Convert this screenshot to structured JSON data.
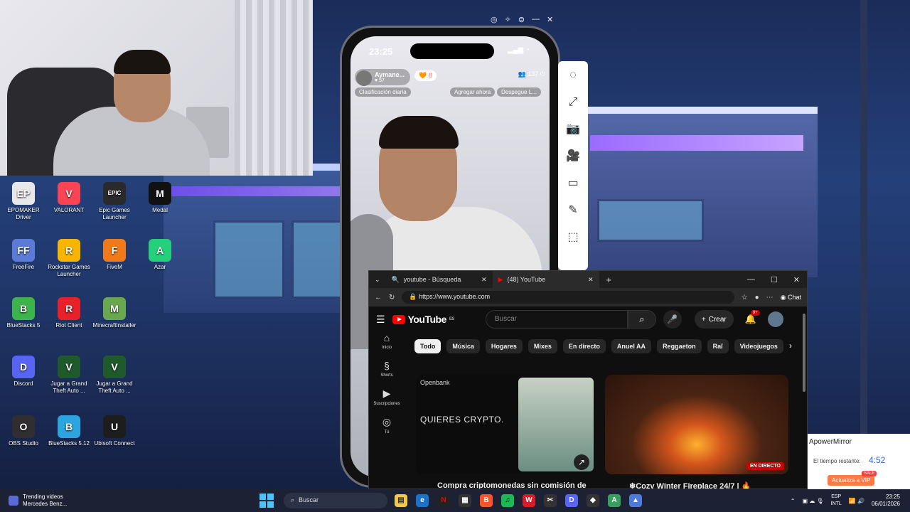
{
  "webcam": {},
  "desktop_icons": [
    {
      "label": "EPOMAKER Driver",
      "icon": "epomaker-icon",
      "color": "#e8e8e8",
      "glyph": "EP"
    },
    {
      "label": "VALORANT",
      "icon": "valorant-icon",
      "color": "#fa4454",
      "glyph": "V"
    },
    {
      "label": "Epic Games Launcher",
      "icon": "epic-games-icon",
      "color": "#2a2a2a",
      "glyph": "EPIC"
    },
    {
      "label": "Medal",
      "icon": "medal-icon",
      "color": "#111111",
      "glyph": "M"
    },
    {
      "label": "FreeFire",
      "icon": "freefire-icon",
      "color": "#5b7bd6",
      "glyph": "FF"
    },
    {
      "label": "Rockstar Games Launcher",
      "icon": "rockstar-icon",
      "color": "#f7b500",
      "glyph": "R"
    },
    {
      "label": "FiveM",
      "icon": "fivem-icon",
      "color": "#f07a1a",
      "glyph": "F"
    },
    {
      "label": "Azar",
      "icon": "azar-icon",
      "color": "#25d07a",
      "glyph": "A"
    },
    {
      "label": "BlueStacks 5",
      "icon": "bluestacks-icon",
      "color": "#3cb44b",
      "glyph": "B"
    },
    {
      "label": "Riot Client",
      "icon": "riot-client-icon",
      "color": "#e8202a",
      "glyph": "R"
    },
    {
      "label": "MinecraftInstaller",
      "icon": "minecraft-icon",
      "color": "#6aa84f",
      "glyph": "M"
    },
    {
      "label": "Discord",
      "icon": "discord-icon",
      "color": "#5865f2",
      "glyph": "D"
    },
    {
      "label": "Jugar a Grand Theft Auto ...",
      "icon": "gta-icon",
      "color": "#1f5a2c",
      "glyph": "V"
    },
    {
      "label": "Jugar a Grand Theft Auto ...",
      "icon": "gta-icon",
      "color": "#1f5a2c",
      "glyph": "V"
    },
    {
      "label": "OBS Studio",
      "icon": "obs-icon",
      "color": "#302e31",
      "glyph": "O"
    },
    {
      "label": "BlueStacks 5.12",
      "icon": "bluestacks-icon",
      "color": "#2ba4e0",
      "glyph": "B"
    },
    {
      "label": "Ubisoft Connect",
      "icon": "ubisoft-icon",
      "color": "#1d1d1d",
      "glyph": "U"
    }
  ],
  "phone": {
    "time": "23:25",
    "username": "Aymane...",
    "likes": "♥ 57",
    "hearts": "🧡 8",
    "viewers": "137",
    "chip_rank": "Clasificación diaria",
    "chip_add": "Agregar ahora",
    "chip_launch": "Despegue L..."
  },
  "browser": {
    "tabs": [
      {
        "label": "youtube - Búsqueda",
        "active": false
      },
      {
        "label": "(48) YouTube",
        "active": true
      }
    ],
    "url": "https://www.youtube.com",
    "chat_label": "Chat"
  },
  "youtube": {
    "logo": "YouTube",
    "region": "ES",
    "search_placeholder": "Buscar",
    "create_label": "Crear",
    "notif_count": "9+",
    "sidebar": [
      {
        "label": "Inicio",
        "icon": "home-icon",
        "glyph": "⌂"
      },
      {
        "label": "Shorts",
        "icon": "shorts-icon",
        "glyph": "§"
      },
      {
        "label": "Suscripciones",
        "icon": "subscriptions-icon",
        "glyph": "▶"
      },
      {
        "label": "Tú",
        "icon": "you-icon",
        "glyph": "◎"
      }
    ],
    "chips": [
      "Todo",
      "Música",
      "Hogares",
      "Mixes",
      "En directo",
      "Anuel AA",
      "Reggaeton",
      "Raï",
      "Videojuegos"
    ],
    "videos": [
      {
        "brand": "Openbank",
        "overlay": "QUIERES CRYPTO.",
        "title": "Compra criptomonedas sin comisión de"
      },
      {
        "badge": "EN DIRECTO",
        "title": "❄Cozy Winter Fireplace 24/7 | 🔥"
      }
    ]
  },
  "apower": {
    "title": "ApowerMirror",
    "time_label": "El tiempo restante:",
    "time_value": "4:52",
    "vip_label": "Actualiza a VIP",
    "sale": "SALE"
  },
  "taskbar": {
    "trend_title": "Trending videos",
    "trend_sub": "Mercedes Benz...",
    "search_placeholder": "Buscar",
    "lang_top": "ESP",
    "lang_bottom": "INTL",
    "time": "23:25",
    "date": "06/01/2026"
  }
}
